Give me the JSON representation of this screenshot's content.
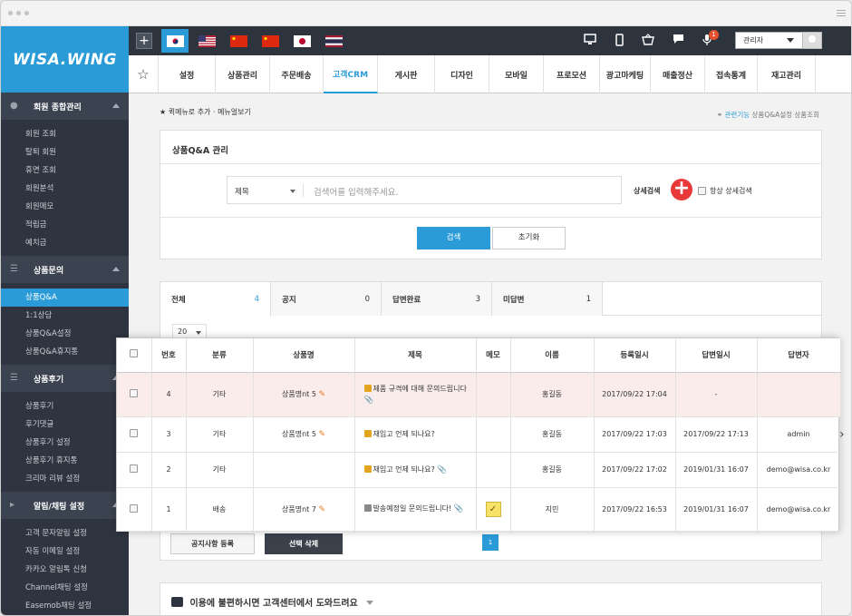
{
  "sidebar": {
    "logo": "WISA.WING",
    "sections": [
      {
        "title": "회원 종합관리",
        "icon": "person-icon",
        "items": [
          "회원 조회",
          "탈퇴 회원",
          "휴면 조회",
          "회원분석",
          "회원메모",
          "적립금",
          "예치금"
        ]
      },
      {
        "title": "상품문의",
        "icon": "list-icon",
        "items": [
          "상품Q&A",
          "1:1상담",
          "상품Q&A설정",
          "상품Q&A휴지통"
        ]
      },
      {
        "title": "상품후기",
        "icon": "checklist-icon",
        "items": [
          "상품후기",
          "후기댓글",
          "상품후기 설정",
          "상품후기 휴지통",
          "크리마 리뷰 설정"
        ]
      },
      {
        "title": "알림/채팅 설정",
        "icon": "megaphone-icon",
        "items": [
          "고객 문자알림 설정",
          "자동 이메일 설정",
          "카카오 알림톡 신청",
          "Channel채팅 설정",
          "Easemob채팅 설정"
        ]
      }
    ],
    "active_item": "상품Q&A"
  },
  "topbar": {
    "flags": [
      "korea-flag",
      "usa-flag",
      "china-flag",
      "china-flag",
      "japan-flag",
      "thailand-flag"
    ],
    "notification_count": "1",
    "user_select": "관리자"
  },
  "nav": {
    "items": [
      "설정",
      "상품관리",
      "주문배송",
      "고객CRM",
      "게시판",
      "디자인",
      "모바일",
      "프로모션",
      "광고마케팅",
      "매출정산",
      "접속통계",
      "재고관리"
    ],
    "active": "고객CRM"
  },
  "breadcrumb": {
    "add_menu": "퀵메뉴로 추가",
    "menu_view": "메뉴얼보기",
    "related_label": "관련기능",
    "related_links": "상품Q&A설정   상품조회"
  },
  "search": {
    "title": "상품Q&A 관리",
    "select_value": "제목",
    "placeholder": "검색어를 입력해주세요.",
    "advanced_label": "상세검색",
    "always_advanced": "항상 상세검색",
    "search_button": "검색",
    "reset_button": "초기화"
  },
  "tabs": [
    {
      "label": "전체",
      "count": "4"
    },
    {
      "label": "공지",
      "count": "0"
    },
    {
      "label": "답변완료",
      "count": "3"
    },
    {
      "label": "미답변",
      "count": "1"
    }
  ],
  "per_page": "20",
  "table": {
    "headers": [
      "번호",
      "분류",
      "상품명",
      "제목",
      "메모",
      "이름",
      "등록일시",
      "답변일시",
      "답변자"
    ],
    "rows": [
      {
        "no": "4",
        "category": "기타",
        "product": "상품명nt 5",
        "title": "제품 규격에 대해 문의드립니다",
        "memo": "",
        "name": "홍길동",
        "registered": "2017/09/22 17:04",
        "answered": "-",
        "answerer": ""
      },
      {
        "no": "3",
        "category": "기타",
        "product": "상품명nt 5",
        "title": "재입고 언제 되나요?",
        "memo": "",
        "name": "홍길동",
        "registered": "2017/09/22 17:03",
        "answered": "2017/09/22 17:13",
        "answerer": "admin"
      },
      {
        "no": "2",
        "category": "기타",
        "product": "",
        "title": "재입고 언제 되나요?",
        "memo": "",
        "name": "홍길동",
        "registered": "2017/09/22 17:02",
        "answered": "2019/01/31 16:07",
        "answerer": "demo@wisa.co.kr"
      },
      {
        "no": "1",
        "category": "배송",
        "product": "상품명nt 7",
        "title": "발송예정일 문의드립니다!",
        "memo": "memo-icon",
        "name": "지민",
        "registered": "2017/09/22 16:53",
        "answered": "2019/01/31 16:07",
        "answerer": "demo@wisa.co.kr"
      }
    ]
  },
  "footer_buttons": {
    "notice_register": "공지사항 등록",
    "delete_selected": "선택 삭제"
  },
  "pagination": {
    "current": "1"
  },
  "help": {
    "text": "이용에 불편하시면 고객센터에서 도와드려요"
  },
  "colors": {
    "accent": "#2b9bd8",
    "sidebar_bg": "#2f3540",
    "highlight_row": "#fbecec"
  }
}
